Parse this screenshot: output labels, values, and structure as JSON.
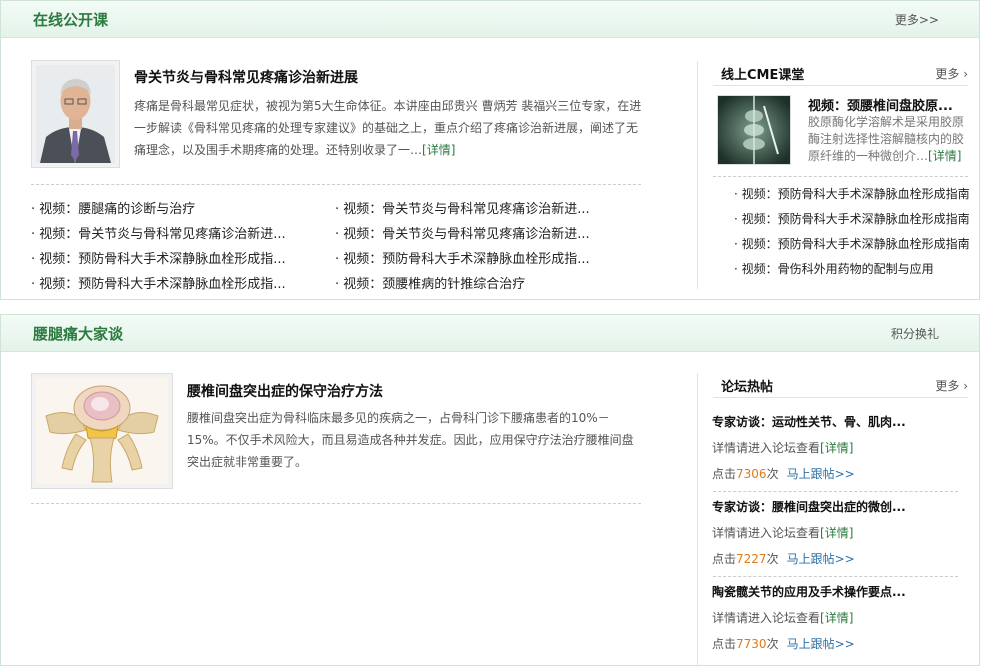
{
  "section1": {
    "title": "在线公开课",
    "more": "更多>>",
    "featured": {
      "title": "骨关节炎与骨科常见疼痛诊治新进展",
      "desc": "疼痛是骨科最常见症状，被视为第5大生命体征。本讲座由邱贵兴 曹炳芳 裴福兴三位专家，在进一步解读《骨科常见疼痛的处理专家建议》的基础之上，重点介绍了疼痛诊治新进展，阐述了无痛理念，以及围手术期疼痛的处理。还特别收录了一…",
      "detail": "[详情]"
    },
    "videos_left": [
      "· 视频：腰腿痛的诊断与治疗",
      "· 视频：骨关节炎与骨科常见疼痛诊治新进...",
      "· 视频：预防骨科大手术深静脉血栓形成指...",
      "· 视频：预防骨科大手术深静脉血栓形成指..."
    ],
    "videos_right": [
      "· 视频：骨关节炎与骨科常见疼痛诊治新进...",
      "· 视频：骨关节炎与骨科常见疼痛诊治新进...",
      "· 视频：预防骨科大手术深静脉血栓形成指...",
      "· 视频：颈腰椎病的针推综合治疗"
    ],
    "cme": {
      "title": "线上CME课堂",
      "more": "更多",
      "feature_title": "视频：颈腰椎间盘胶原...",
      "feature_desc": "胶原酶化学溶解术是采用胶原酶注射选择性溶解髓核内的胶原纤维的一种微创介…",
      "detail": "[详情]",
      "items": [
        "· 视频：预防骨科大手术深静脉血栓形成指南",
        "· 视频：预防骨科大手术深静脉血栓形成指南",
        "· 视频：预防骨科大手术深静脉血栓形成指南",
        "· 视频：骨伤科外用药物的配制与应用"
      ]
    }
  },
  "section2": {
    "title": "腰腿痛大家谈",
    "more": "积分换礼",
    "featured": {
      "title": "腰椎间盘突出症的保守治疗方法",
      "desc": "腰椎间盘突出症为骨科临床最多见的疾病之一，占骨科门诊下腰痛患者的10%－15%。不仅手术风险大，而且易造成各种并发症。因此，应用保守疗法治疗腰椎间盘突出症就非常重要了。"
    },
    "forum": {
      "title": "论坛热帖",
      "more": "更多",
      "posts": [
        {
          "title": "专家访谈：运动性关节、骨、肌肉...",
          "prompt": "详情请进入论坛查看",
          "detail": "[详情]",
          "click_pre": "点击",
          "count": "7306",
          "click_post": "次",
          "follow": "马上跟帖>>"
        },
        {
          "title": "专家访谈：腰椎间盘突出症的微创...",
          "prompt": "详情请进入论坛查看",
          "detail": "[详情]",
          "click_pre": "点击",
          "count": "7227",
          "click_post": "次",
          "follow": "马上跟帖>>"
        },
        {
          "title": "陶瓷髋关节的应用及手术操作要点...",
          "prompt": "详情请进入论坛查看",
          "detail": "[详情]",
          "click_pre": "点击",
          "count": "7730",
          "click_post": "次",
          "follow": "马上跟帖>>"
        }
      ]
    }
  },
  "colors": {
    "accent": "#2b7a3f",
    "count": "#e07a1a",
    "link": "#2b6fa6"
  }
}
